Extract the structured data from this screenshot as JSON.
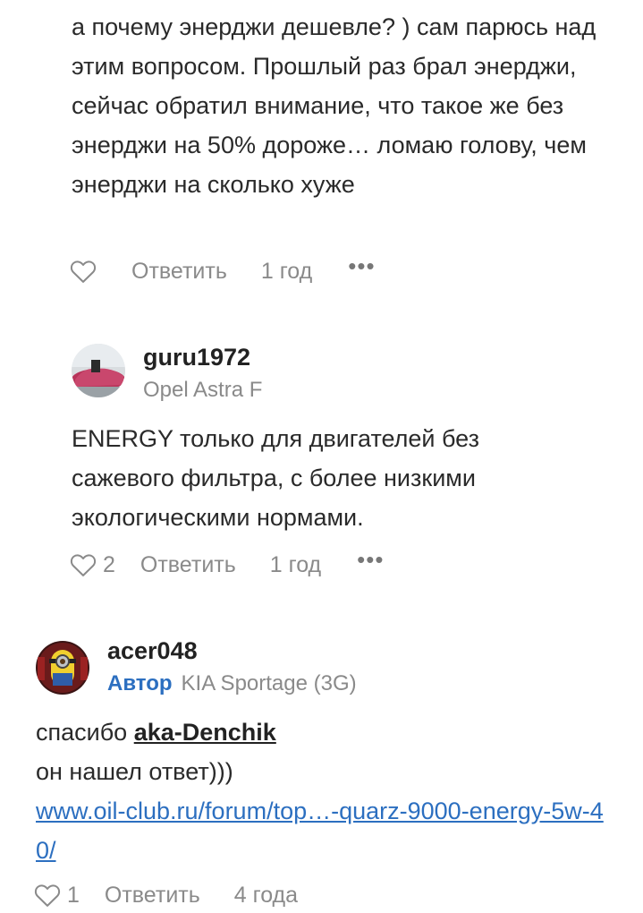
{
  "comments": [
    {
      "text": "а почему энерджи дешевле? ) сам парюсь над этим вопросом. Прошлый раз брал энерджи, сейчас обратил внимание, что такое же без энерджи на 50% дороже… ломаю голову, чем энерджи на сколько хуже",
      "reply": "Ответить",
      "time": "1 год",
      "more": "•••"
    },
    {
      "username": "guru1972",
      "car": "Opel Astra F",
      "text": "ENERGY только для двигателей без сажевого фильтра, с более низкими экологическими нормами.",
      "likes": "2",
      "reply": "Ответить",
      "time": "1 год",
      "more": "•••"
    },
    {
      "username": "acer048",
      "badge": "Автор",
      "car": "KIA Sportage (3G)",
      "text_prefix": "спасибо",
      "mention": "aka-Denchik",
      "text_line2": "он нашел ответ)))",
      "link": "www.oil-club.ru/forum/top…-quarz-9000-energy-5w-40/",
      "likes": "1",
      "reply": "Ответить",
      "time": "4 года"
    }
  ],
  "colors": {
    "accent": "#2c6fc0",
    "muted": "#8a8a8a",
    "text": "#2a2a2a"
  },
  "icons": {
    "like": "heart-outline-icon",
    "more": "more-dots-icon"
  }
}
